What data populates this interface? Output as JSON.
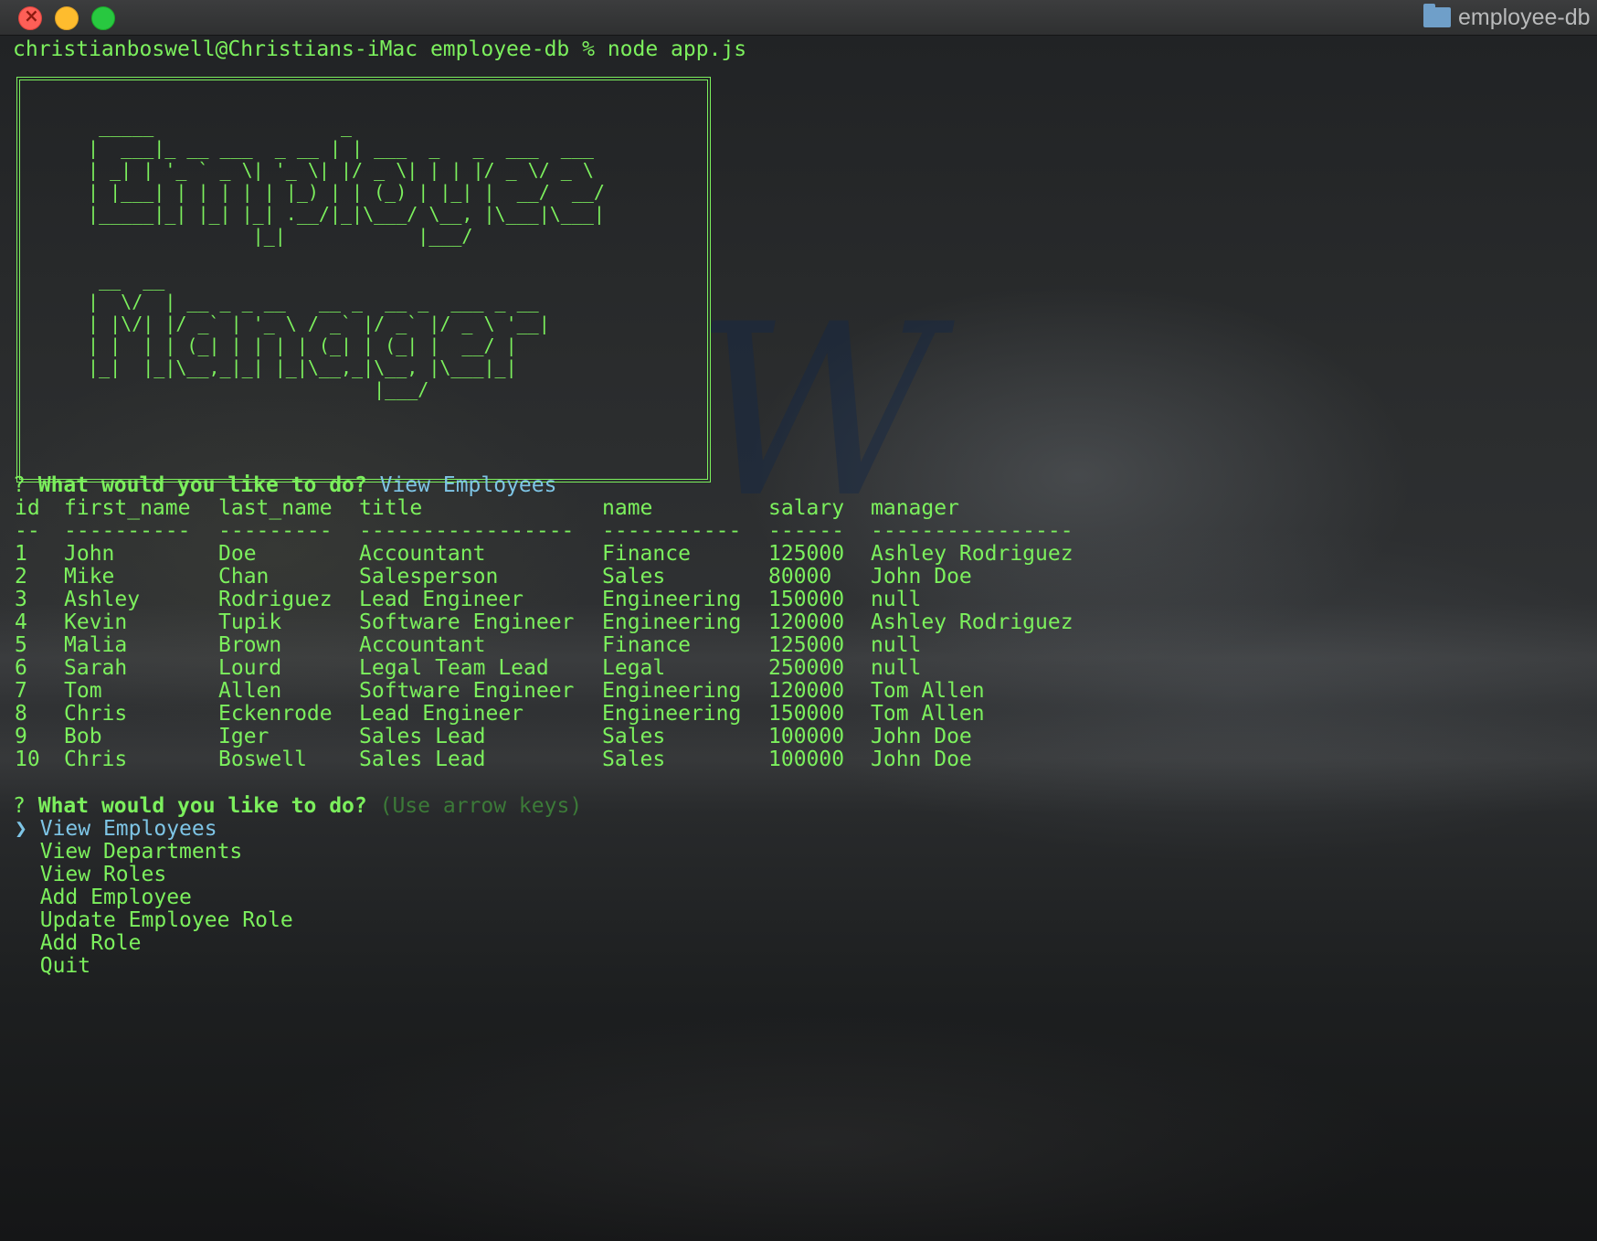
{
  "window": {
    "title": "employee-db",
    "folder_icon": "folder-icon"
  },
  "terminal": {
    "prompt_line": "christianboswell@Christians-iMac employee-db % node app.js",
    "banner_ascii": "  _____                 _                       \n |  ___|_ __ ___  _ __ | | ___  _   _  ___  ___ \n | _| | '_ ` _ \\| '_ \\| |/ _ \\| | | |/ _ \\/ _ \\\n | |___| | | | | | |_) | | (_) | |_| |  __/  __/\n |_____|_| |_| |_| .__/|_|\\___/ \\__, |\\___|\\___|\n                |_|            |___/           \n\n  __  __\n |  \\/  | __ _ _ __   __ _  __ _  ___ _ __\n | |\\/| |/ _` | '_ \\ / _` |/ _` |/ _ \\ '__|\n | |  | | (_| | | | | (_| | (_| |  __/ |\n |_|  |_|\\__,_|_| |_|\\__,_|\\__, |\\___|_|\n                           |___/",
    "question_mark": "?",
    "question": "What would you like to do?",
    "first_answer": "View Employees",
    "hint": "(Use arrow keys)",
    "pointer": "❯"
  },
  "table": {
    "headers": [
      "id",
      "first_name",
      "last_name",
      "title",
      "name",
      "salary",
      "manager"
    ],
    "separators": [
      "--",
      "----------",
      "---------",
      "-----------------",
      "-----------",
      "------",
      "----------------"
    ],
    "rows": [
      [
        "1",
        "John",
        "Doe",
        "Accountant",
        "Finance",
        "125000",
        "Ashley Rodriguez"
      ],
      [
        "2",
        "Mike",
        "Chan",
        "Salesperson",
        "Sales",
        "80000",
        "John Doe"
      ],
      [
        "3",
        "Ashley",
        "Rodriguez",
        "Lead Engineer",
        "Engineering",
        "150000",
        "null"
      ],
      [
        "4",
        "Kevin",
        "Tupik",
        "Software Engineer",
        "Engineering",
        "120000",
        "Ashley Rodriguez"
      ],
      [
        "5",
        "Malia",
        "Brown",
        "Accountant",
        "Finance",
        "125000",
        "null"
      ],
      [
        "6",
        "Sarah",
        "Lourd",
        "Legal Team Lead",
        "Legal",
        "250000",
        "null"
      ],
      [
        "7",
        "Tom",
        "Allen",
        "Software Engineer",
        "Engineering",
        "120000",
        "Tom Allen"
      ],
      [
        "8",
        "Chris",
        "Eckenrode",
        "Lead Engineer",
        "Engineering",
        "150000",
        "Tom Allen"
      ],
      [
        "9",
        "Bob",
        "Iger",
        "Sales Lead",
        "Sales",
        "100000",
        "John Doe"
      ],
      [
        "10",
        "Chris",
        "Boswell",
        "Sales Lead",
        "Sales",
        "100000",
        "John Doe"
      ]
    ]
  },
  "menu": {
    "selected_index": 0,
    "items": [
      "View Employees",
      "View Departments",
      "View Roles",
      "Add Employee",
      "Update Employee Role",
      "Add Role",
      "Quit"
    ]
  },
  "colors": {
    "terminal_green": "#7cf05d",
    "answer_cyan": "#7ec5e6",
    "hint_dim_green": "#3c7a38"
  }
}
